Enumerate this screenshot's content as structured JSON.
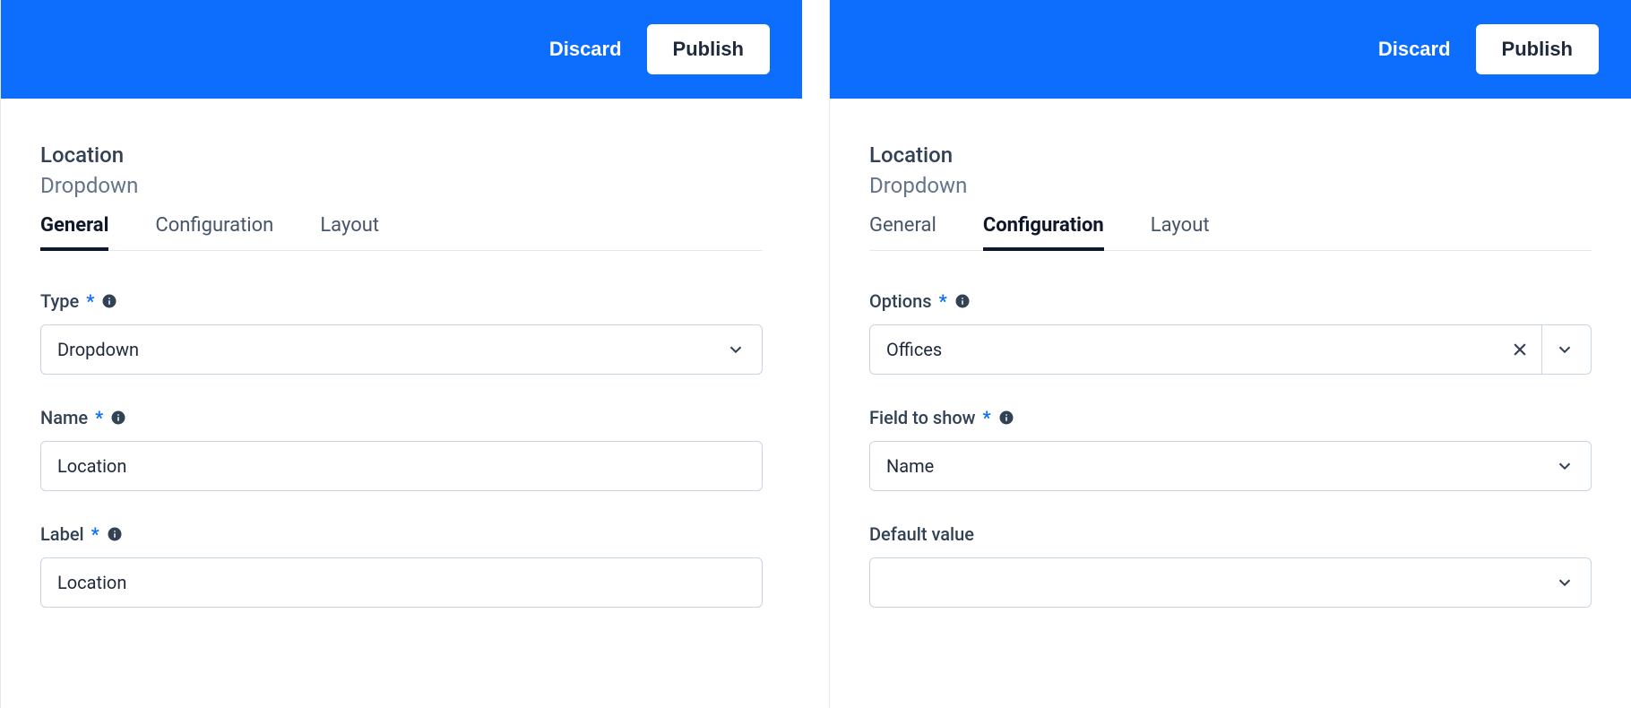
{
  "left": {
    "topbar": {
      "discard": "Discard",
      "publish": "Publish"
    },
    "title": "Location",
    "subtitle": "Dropdown",
    "tabs": [
      {
        "label": "General",
        "active": true
      },
      {
        "label": "Configuration",
        "active": false
      },
      {
        "label": "Layout",
        "active": false
      }
    ],
    "fields": {
      "type": {
        "label": "Type",
        "required": true,
        "value": "Dropdown"
      },
      "name": {
        "label": "Name",
        "required": true,
        "value": "Location"
      },
      "label": {
        "label": "Label",
        "required": true,
        "value": "Location"
      }
    }
  },
  "right": {
    "topbar": {
      "discard": "Discard",
      "publish": "Publish"
    },
    "title": "Location",
    "subtitle": "Dropdown",
    "tabs": [
      {
        "label": "General",
        "active": false
      },
      {
        "label": "Configuration",
        "active": true
      },
      {
        "label": "Layout",
        "active": false
      }
    ],
    "fields": {
      "options": {
        "label": "Options",
        "required": true,
        "value": "Offices"
      },
      "field_to_show": {
        "label": "Field to show",
        "required": true,
        "value": "Name"
      },
      "default_value": {
        "label": "Default value",
        "required": false,
        "value": ""
      }
    }
  }
}
